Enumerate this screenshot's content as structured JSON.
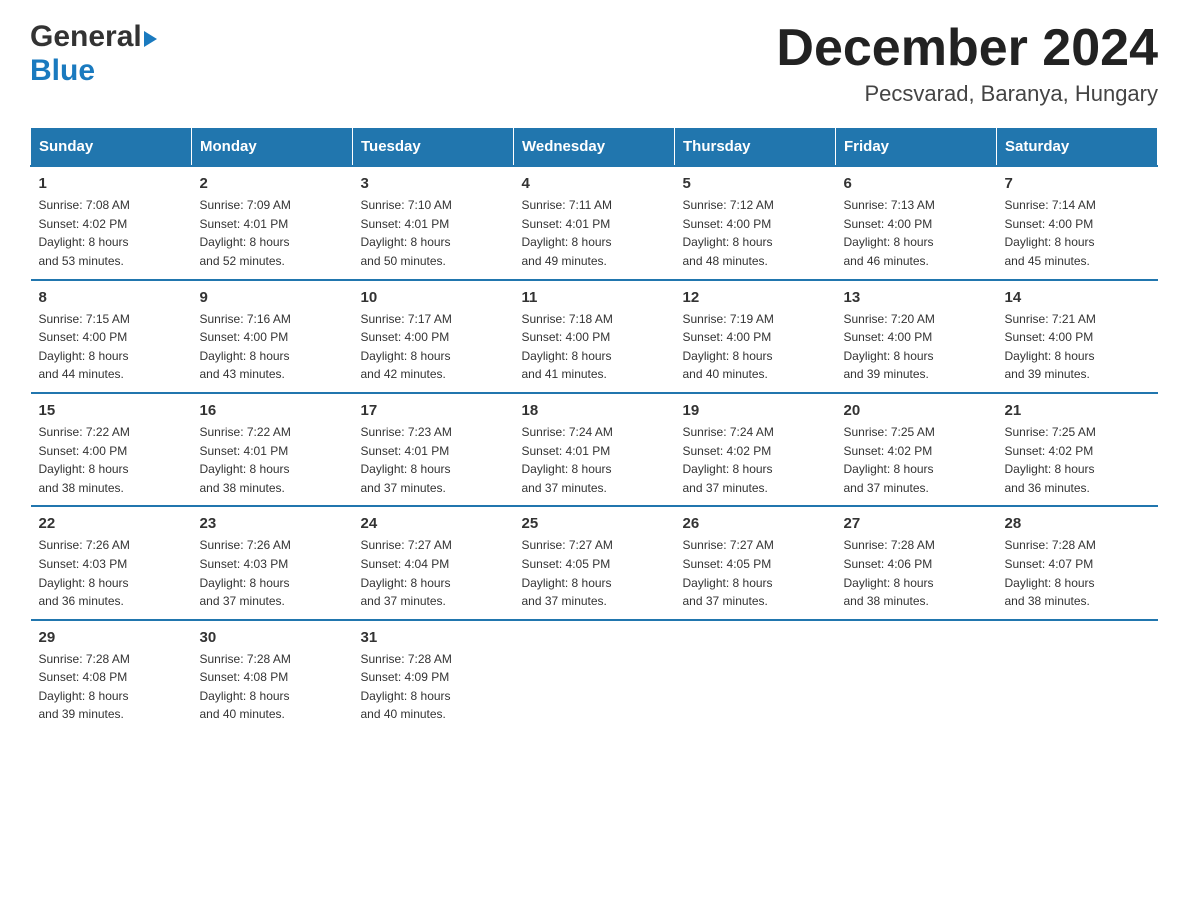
{
  "header": {
    "logo_general": "General",
    "logo_blue": "Blue",
    "month_title": "December 2024",
    "location": "Pecsvarad, Baranya, Hungary"
  },
  "weekdays": [
    "Sunday",
    "Monday",
    "Tuesday",
    "Wednesday",
    "Thursday",
    "Friday",
    "Saturday"
  ],
  "weeks": [
    [
      {
        "day": "1",
        "sunrise": "7:08 AM",
        "sunset": "4:02 PM",
        "daylight": "8 hours and 53 minutes."
      },
      {
        "day": "2",
        "sunrise": "7:09 AM",
        "sunset": "4:01 PM",
        "daylight": "8 hours and 52 minutes."
      },
      {
        "day": "3",
        "sunrise": "7:10 AM",
        "sunset": "4:01 PM",
        "daylight": "8 hours and 50 minutes."
      },
      {
        "day": "4",
        "sunrise": "7:11 AM",
        "sunset": "4:01 PM",
        "daylight": "8 hours and 49 minutes."
      },
      {
        "day": "5",
        "sunrise": "7:12 AM",
        "sunset": "4:00 PM",
        "daylight": "8 hours and 48 minutes."
      },
      {
        "day": "6",
        "sunrise": "7:13 AM",
        "sunset": "4:00 PM",
        "daylight": "8 hours and 46 minutes."
      },
      {
        "day": "7",
        "sunrise": "7:14 AM",
        "sunset": "4:00 PM",
        "daylight": "8 hours and 45 minutes."
      }
    ],
    [
      {
        "day": "8",
        "sunrise": "7:15 AM",
        "sunset": "4:00 PM",
        "daylight": "8 hours and 44 minutes."
      },
      {
        "day": "9",
        "sunrise": "7:16 AM",
        "sunset": "4:00 PM",
        "daylight": "8 hours and 43 minutes."
      },
      {
        "day": "10",
        "sunrise": "7:17 AM",
        "sunset": "4:00 PM",
        "daylight": "8 hours and 42 minutes."
      },
      {
        "day": "11",
        "sunrise": "7:18 AM",
        "sunset": "4:00 PM",
        "daylight": "8 hours and 41 minutes."
      },
      {
        "day": "12",
        "sunrise": "7:19 AM",
        "sunset": "4:00 PM",
        "daylight": "8 hours and 40 minutes."
      },
      {
        "day": "13",
        "sunrise": "7:20 AM",
        "sunset": "4:00 PM",
        "daylight": "8 hours and 39 minutes."
      },
      {
        "day": "14",
        "sunrise": "7:21 AM",
        "sunset": "4:00 PM",
        "daylight": "8 hours and 39 minutes."
      }
    ],
    [
      {
        "day": "15",
        "sunrise": "7:22 AM",
        "sunset": "4:00 PM",
        "daylight": "8 hours and 38 minutes."
      },
      {
        "day": "16",
        "sunrise": "7:22 AM",
        "sunset": "4:01 PM",
        "daylight": "8 hours and 38 minutes."
      },
      {
        "day": "17",
        "sunrise": "7:23 AM",
        "sunset": "4:01 PM",
        "daylight": "8 hours and 37 minutes."
      },
      {
        "day": "18",
        "sunrise": "7:24 AM",
        "sunset": "4:01 PM",
        "daylight": "8 hours and 37 minutes."
      },
      {
        "day": "19",
        "sunrise": "7:24 AM",
        "sunset": "4:02 PM",
        "daylight": "8 hours and 37 minutes."
      },
      {
        "day": "20",
        "sunrise": "7:25 AM",
        "sunset": "4:02 PM",
        "daylight": "8 hours and 37 minutes."
      },
      {
        "day": "21",
        "sunrise": "7:25 AM",
        "sunset": "4:02 PM",
        "daylight": "8 hours and 36 minutes."
      }
    ],
    [
      {
        "day": "22",
        "sunrise": "7:26 AM",
        "sunset": "4:03 PM",
        "daylight": "8 hours and 36 minutes."
      },
      {
        "day": "23",
        "sunrise": "7:26 AM",
        "sunset": "4:03 PM",
        "daylight": "8 hours and 37 minutes."
      },
      {
        "day": "24",
        "sunrise": "7:27 AM",
        "sunset": "4:04 PM",
        "daylight": "8 hours and 37 minutes."
      },
      {
        "day": "25",
        "sunrise": "7:27 AM",
        "sunset": "4:05 PM",
        "daylight": "8 hours and 37 minutes."
      },
      {
        "day": "26",
        "sunrise": "7:27 AM",
        "sunset": "4:05 PM",
        "daylight": "8 hours and 37 minutes."
      },
      {
        "day": "27",
        "sunrise": "7:28 AM",
        "sunset": "4:06 PM",
        "daylight": "8 hours and 38 minutes."
      },
      {
        "day": "28",
        "sunrise": "7:28 AM",
        "sunset": "4:07 PM",
        "daylight": "8 hours and 38 minutes."
      }
    ],
    [
      {
        "day": "29",
        "sunrise": "7:28 AM",
        "sunset": "4:08 PM",
        "daylight": "8 hours and 39 minutes."
      },
      {
        "day": "30",
        "sunrise": "7:28 AM",
        "sunset": "4:08 PM",
        "daylight": "8 hours and 40 minutes."
      },
      {
        "day": "31",
        "sunrise": "7:28 AM",
        "sunset": "4:09 PM",
        "daylight": "8 hours and 40 minutes."
      },
      null,
      null,
      null,
      null
    ]
  ],
  "labels": {
    "sunrise": "Sunrise:",
    "sunset": "Sunset:",
    "daylight": "Daylight:"
  }
}
